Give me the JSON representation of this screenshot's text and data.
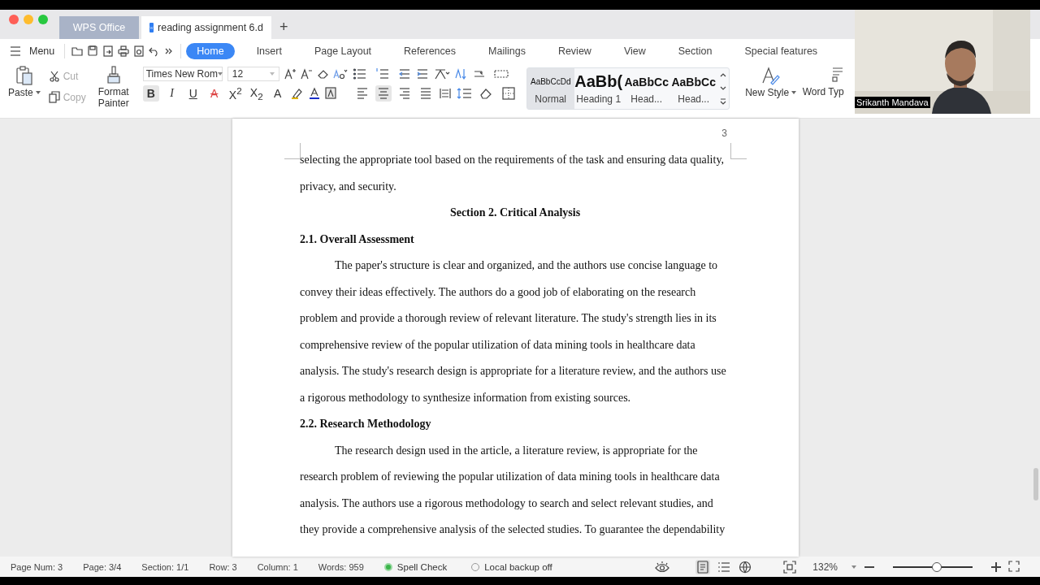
{
  "window": {
    "tabs": [
      {
        "label": "WPS Office",
        "selected": false
      },
      {
        "label": "reading assignment 6.d",
        "selected": true
      }
    ],
    "new_tab": "+"
  },
  "menu": {
    "label": "Menu"
  },
  "ribbon_tabs": [
    {
      "label": "Home",
      "selected": true
    },
    {
      "label": "Insert",
      "selected": false
    },
    {
      "label": "Page Layout",
      "selected": false
    },
    {
      "label": "References",
      "selected": false
    },
    {
      "label": "Mailings",
      "selected": false
    },
    {
      "label": "Review",
      "selected": false
    },
    {
      "label": "View",
      "selected": false
    },
    {
      "label": "Section",
      "selected": false
    },
    {
      "label": "Special features",
      "selected": false
    }
  ],
  "clipboard": {
    "paste": "Paste",
    "cut": {
      "label": "Cut",
      "disabled": true
    },
    "copy": {
      "label": "Copy",
      "disabled": true
    },
    "format_painter": "Format Painter"
  },
  "font": {
    "name": "Times New Rom",
    "size": "12"
  },
  "format_buttons": [
    {
      "kind": "bold",
      "label": "B",
      "selected": true
    },
    {
      "kind": "italic",
      "label": "I",
      "selected": false
    },
    {
      "kind": "underline",
      "label": "U",
      "selected": false
    },
    {
      "kind": "strike",
      "label": "A",
      "selected": false
    },
    {
      "kind": "super",
      "label": "X$^{2}$",
      "selected": false
    },
    {
      "kind": "sub",
      "label": "X$_{2}$",
      "selected": false
    },
    {
      "kind": "effects",
      "label": "A",
      "selected": false
    }
  ],
  "align_buttons": [
    {
      "kind": "left",
      "selected": false
    },
    {
      "kind": "center",
      "selected": true
    },
    {
      "kind": "right",
      "selected": false
    },
    {
      "kind": "justify",
      "selected": false
    }
  ],
  "styles": [
    {
      "kind": "normal",
      "preview": "AaBbCcDd",
      "label": "Normal",
      "selected": true
    },
    {
      "kind": "h1",
      "preview": "AaBb(",
      "label": "Heading 1",
      "selected": false
    },
    {
      "kind": "h2",
      "preview": "AaBbCc",
      "label": "Head...",
      "selected": false
    },
    {
      "kind": "h3",
      "preview": "AaBbCc",
      "label": "Head...",
      "selected": false
    }
  ],
  "new_style": "New Style",
  "word_type": "Word Typ",
  "video": {
    "name": "Srikanth Mandava"
  },
  "document": {
    "page_number": "3",
    "blocks": [
      {
        "kind": "text",
        "text": "selecting the appropriate tool based on the requirements of the task and ensuring data quality, privacy, and security."
      },
      {
        "kind": "title",
        "text": "Section 2. Critical Analysis"
      },
      {
        "kind": "heading",
        "text": "2.1. Overall Assessment"
      },
      {
        "kind": "para",
        "text": "The paper's structure is clear and organized, and the authors use concise language to convey their ideas effectively. The authors do a good job of elaborating on the research problem and provide a thorough review of relevant literature. The study's strength lies in its comprehensive review of the popular utilization of data mining tools in healthcare data analysis. The study's research design is appropriate for a literature review, and the authors use a rigorous methodology to synthesize information from existing sources."
      },
      {
        "kind": "heading",
        "text": "2.2. Research Methodology"
      },
      {
        "kind": "para",
        "text": "The research design used in the article, a literature review, is appropriate for the research problem of reviewing the popular utilization of data mining tools in healthcare data analysis. The authors use a rigorous methodology to search and select relevant studies, and they provide a comprehensive analysis of the selected studies. To guarantee the dependability"
      }
    ]
  },
  "status": {
    "items": [
      "Page Num: 3",
      "Page: 3/4",
      "Section: 1/1",
      "Row: 3",
      "Column: 1",
      "Words: 959"
    ],
    "toggles": [
      {
        "label": "Spell Check",
        "on": true
      },
      {
        "label": "Local backup off",
        "on": false
      }
    ],
    "view_modes": [
      {
        "kind": "page",
        "selected": true
      },
      {
        "kind": "outline",
        "selected": false
      },
      {
        "kind": "web",
        "selected": false
      }
    ],
    "zoom": "132%",
    "level": 0.55
  }
}
